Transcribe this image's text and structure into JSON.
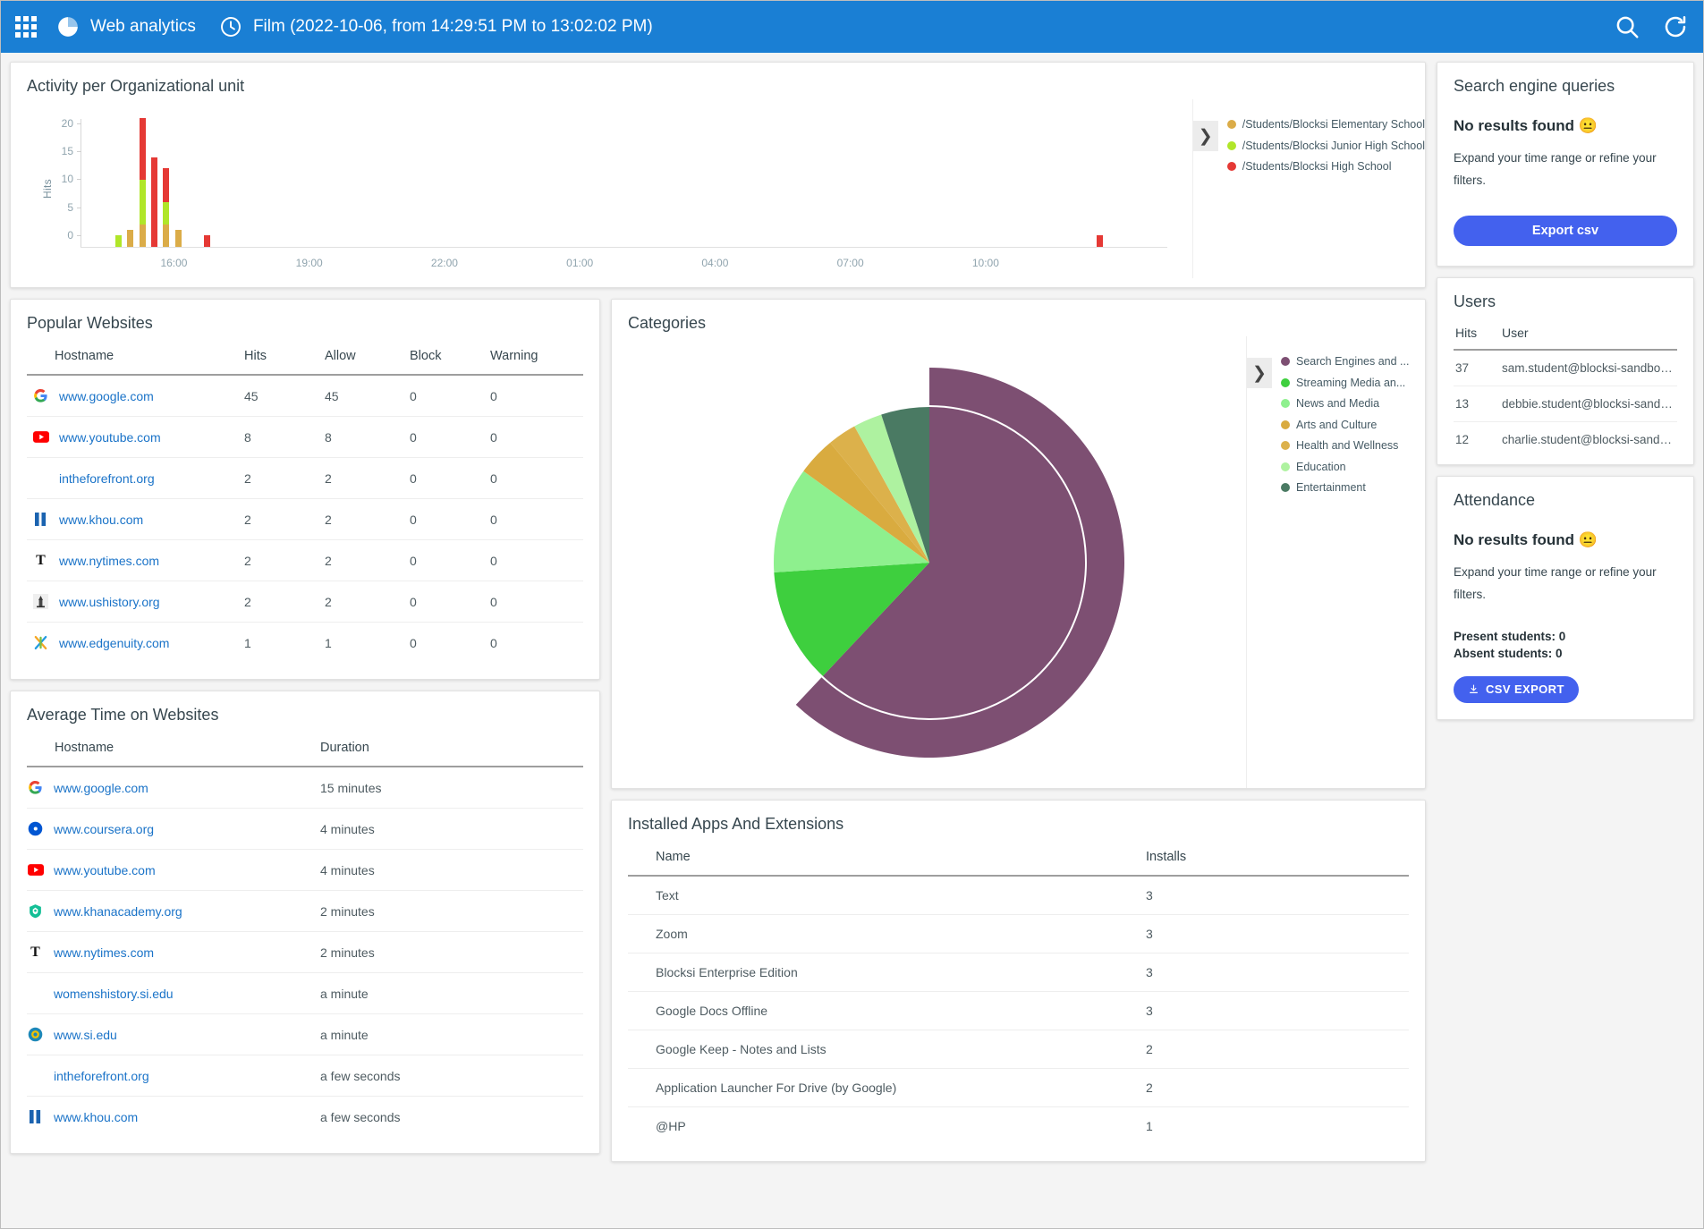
{
  "topbar": {
    "apps_icon": "grid-apps-icon",
    "brand_icon": "blocksi-pie-logo-icon",
    "title": "Web analytics",
    "clock_icon": "clock-icon",
    "range": "Film (2022-10-06, from 14:29:51 PM to 13:02:02 PM)",
    "search_icon": "search-icon",
    "refresh_icon": "refresh-icon"
  },
  "activity": {
    "title": "Activity per Organizational unit",
    "expand_icon": "chevron-right-icon",
    "ylabel": "Hits",
    "legend": [
      {
        "label": "/Students/Blocksi Elementary School",
        "color": "#dbac48"
      },
      {
        "label": "/Students/Blocksi Junior High School",
        "color": "#b0e629"
      },
      {
        "label": "/Students/Blocksi High School",
        "color": "#e53935"
      }
    ]
  },
  "popular_websites": {
    "title": "Popular Websites",
    "columns": [
      "Hostname",
      "Hits",
      "Allow",
      "Block",
      "Warning"
    ],
    "rows": [
      {
        "icon": "google-favicon",
        "host": "www.google.com",
        "hits": "45",
        "allow": "45",
        "block": "0",
        "warning": "0"
      },
      {
        "icon": "youtube-favicon",
        "host": "www.youtube.com",
        "hits": "8",
        "allow": "8",
        "block": "0",
        "warning": "0"
      },
      {
        "icon": "none",
        "host": "intheforefront.org",
        "hits": "2",
        "allow": "2",
        "block": "0",
        "warning": "0"
      },
      {
        "icon": "khou-favicon",
        "host": "www.khou.com",
        "hits": "2",
        "allow": "2",
        "block": "0",
        "warning": "0"
      },
      {
        "icon": "nytimes-favicon",
        "host": "www.nytimes.com",
        "hits": "2",
        "allow": "2",
        "block": "0",
        "warning": "0"
      },
      {
        "icon": "ushistory-favicon",
        "host": "www.ushistory.org",
        "hits": "2",
        "allow": "2",
        "block": "0",
        "warning": "0"
      },
      {
        "icon": "edgenuity-favicon",
        "host": "www.edgenuity.com",
        "hits": "1",
        "allow": "1",
        "block": "0",
        "warning": "0"
      }
    ]
  },
  "average_time": {
    "title": "Average Time on Websites",
    "columns": [
      "Hostname",
      "Duration"
    ],
    "rows": [
      {
        "icon": "google-favicon",
        "host": "www.google.com",
        "duration": "15 minutes"
      },
      {
        "icon": "coursera-favicon",
        "host": "www.coursera.org",
        "duration": "4 minutes"
      },
      {
        "icon": "youtube-favicon",
        "host": "www.youtube.com",
        "duration": "4 minutes"
      },
      {
        "icon": "khanacademy-favicon",
        "host": "www.khanacademy.org",
        "duration": "2 minutes"
      },
      {
        "icon": "nytimes-favicon",
        "host": "www.nytimes.com",
        "duration": "2 minutes"
      },
      {
        "icon": "none",
        "host": "womenshistory.si.edu",
        "duration": "a minute"
      },
      {
        "icon": "si-favicon",
        "host": "www.si.edu",
        "duration": "a minute"
      },
      {
        "icon": "none",
        "host": "intheforefront.org",
        "duration": "a few seconds"
      },
      {
        "icon": "khou-favicon",
        "host": "www.khou.com",
        "duration": "a few seconds"
      }
    ]
  },
  "categories": {
    "title": "Categories",
    "expand_icon": "chevron-right-icon"
  },
  "installed_apps": {
    "title": "Installed Apps And Extensions",
    "columns": [
      "Name",
      "Installs"
    ],
    "rows": [
      {
        "name": "Text",
        "installs": "3"
      },
      {
        "name": "Zoom",
        "installs": "3"
      },
      {
        "name": "Blocksi Enterprise Edition",
        "installs": "3"
      },
      {
        "name": "Google Docs Offline",
        "installs": "3"
      },
      {
        "name": "Google Keep - Notes and Lists",
        "installs": "2"
      },
      {
        "name": "Application Launcher For Drive (by Google)",
        "installs": "2"
      },
      {
        "name": "@HP",
        "installs": "1"
      }
    ]
  },
  "search_engine_queries": {
    "title": "Search engine queries",
    "empty_title": "No results found 😐",
    "empty_sub": "Expand your time range or refine your filters.",
    "export_label": "Export csv"
  },
  "users": {
    "title": "Users",
    "columns": [
      "Hits",
      "User"
    ],
    "rows": [
      {
        "hits": "37",
        "user": "sam.student@blocksi-sandbox...."
      },
      {
        "hits": "13",
        "user": "debbie.student@blocksi-sandb..."
      },
      {
        "hits": "12",
        "user": "charlie.student@blocksi-sandb..."
      }
    ]
  },
  "attendance": {
    "title": "Attendance",
    "empty_title": "No results found 😐",
    "empty_sub": "Expand your time range or refine your filters.",
    "present": "Present students: 0",
    "absent": "Absent students: 0",
    "csv_icon": "download-icon",
    "csv_label": "CSV EXPORT"
  },
  "colors": {
    "accent": "#1a7fd4",
    "button": "#4361ee",
    "link": "#1a73c8"
  },
  "chart_data": [
    {
      "type": "bar",
      "id": "activity-per-org-unit",
      "title": "Activity per Organizational unit",
      "xlabel": "",
      "ylabel": "Hits",
      "ylim": [
        0,
        23
      ],
      "yticks": [
        0,
        5,
        10,
        15,
        20
      ],
      "xticks": [
        "16:00",
        "19:00",
        "22:00",
        "01:00",
        "04:00",
        "07:00",
        "10:00"
      ],
      "stacked": true,
      "grid": false,
      "legend_position": "right",
      "series": [
        {
          "name": "/Students/Blocksi Elementary School",
          "color": "#dbac48"
        },
        {
          "name": "/Students/Blocksi Junior High School",
          "color": "#b0e629"
        },
        {
          "name": "/Students/Blocksi High School",
          "color": "#e53935"
        }
      ],
      "bars": [
        {
          "x_pct": 3.2,
          "elementary": 0,
          "junior": 2,
          "high": 0
        },
        {
          "x_pct": 4.3,
          "elementary": 3,
          "junior": 0,
          "high": 0
        },
        {
          "x_pct": 5.4,
          "elementary": 4,
          "junior": 8,
          "high": 11
        },
        {
          "x_pct": 6.5,
          "elementary": 0,
          "junior": 0,
          "high": 16
        },
        {
          "x_pct": 7.6,
          "elementary": 4,
          "junior": 4,
          "high": 6
        },
        {
          "x_pct": 8.7,
          "elementary": 3,
          "junior": 0,
          "high": 0
        },
        {
          "x_pct": 11.4,
          "elementary": 0,
          "junior": 0,
          "high": 2
        },
        {
          "x_pct": 93.5,
          "elementary": 0,
          "junior": 0,
          "high": 2
        }
      ]
    },
    {
      "type": "pie",
      "id": "categories-donut",
      "title": "Categories",
      "legend_position": "right",
      "labels": [
        "Search Engines and ...",
        "Streaming Media an...",
        "News and Media",
        "Arts and Culture",
        "Health and Wellness",
        "Education",
        "Entertainment"
      ],
      "colors": [
        "#7d4f72",
        "#3ecf3e",
        "#8ef08e",
        "#d9ab3f",
        "#dcb14b",
        "#aef2a0",
        "#4a7a63"
      ],
      "values": [
        62,
        12,
        11,
        4,
        3,
        3,
        5
      ]
    }
  ]
}
